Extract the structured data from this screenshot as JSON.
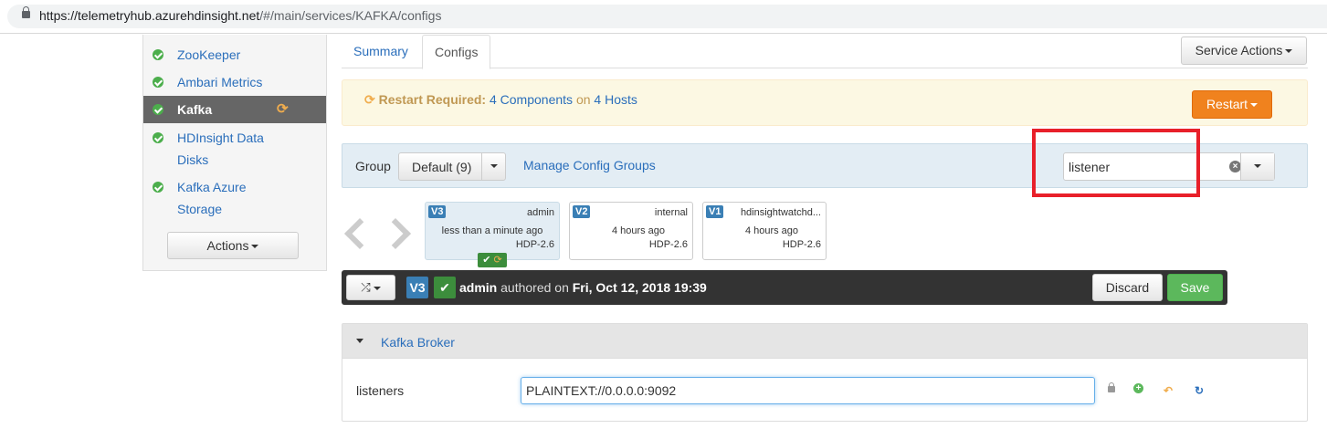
{
  "browser": {
    "url_host": "https://telemetryhub.azurehdinsight.net",
    "url_path": "/#/main/services/KAFKA/configs"
  },
  "sidebar": {
    "items": [
      {
        "label": "ZooKeeper"
      },
      {
        "label": "Ambari Metrics"
      },
      {
        "label": "Kafka"
      },
      {
        "label": "HDInsight Data Disks"
      },
      {
        "label": "Kafka Azure Storage"
      }
    ],
    "actions_label": "Actions"
  },
  "tabs": [
    {
      "label": "Summary"
    },
    {
      "label": "Configs"
    }
  ],
  "service_actions_label": "Service Actions",
  "restart": {
    "required_label": "Restart Required:",
    "components_link": "4 Components",
    "on_text": "on",
    "hosts_link": "4 Hosts",
    "button_label": "Restart"
  },
  "group": {
    "label": "Group",
    "selected": "Default (9)",
    "manage_link": "Manage Config Groups",
    "filter_value": "listener"
  },
  "versions": [
    {
      "badge": "V3",
      "author": "admin",
      "time": "less than a minute ago",
      "stack": "HDP-2.6"
    },
    {
      "badge": "V2",
      "author": "internal",
      "time": "4 hours ago",
      "stack": "HDP-2.6"
    },
    {
      "badge": "V1",
      "author": "hdinsightwatchd...",
      "time": "4 hours ago",
      "stack": "HDP-2.6"
    }
  ],
  "current_bar": {
    "version": "V3",
    "author": "admin",
    "authored_on_text": "authored on",
    "date": "Fri, Oct 12, 2018 19:39",
    "discard_label": "Discard",
    "save_label": "Save"
  },
  "section": {
    "title": "Kafka Broker",
    "property_name": "listeners",
    "property_value": "PLAINTEXT://0.0.0.0:9092"
  },
  "colors": {
    "link": "#2a6ebb",
    "restart": "#f0821e",
    "save": "#5cb85c",
    "highlight_box": "#e8202a"
  }
}
